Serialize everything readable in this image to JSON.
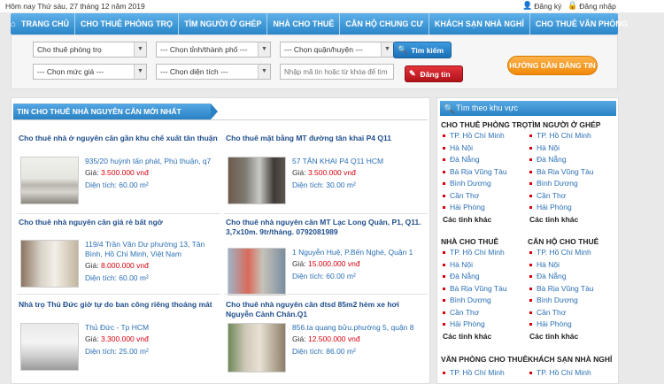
{
  "topbar": {
    "date": "Hôm nay Thứ sáu, 27 tháng 12 năm 2019",
    "register": "Đăng ký",
    "login": "Đăng nhập"
  },
  "nav": {
    "items": [
      "TRANG CHỦ",
      "CHO THUÊ PHÒNG TRỌ",
      "TÌM NGƯỜI Ở GHÉP",
      "NHÀ CHO THUÊ",
      "CĂN HỘ CHUNG CƯ",
      "KHÁCH SẠN NHÀ NGHỈ",
      "CHO THUÊ VĂN PHÒNG"
    ]
  },
  "search": {
    "category": "Cho thuê phòng trọ",
    "province": "--- Chọn tỉnh/thành phố ---",
    "district": "--- Chọn quận/huyện ---",
    "price": "--- Chọn mức giá ---",
    "area": "--- Chọn diện tích ---",
    "keyword_placeholder": "Nhập mã tin hoặc từ khóa để tìm",
    "search_label": "Tìm kiếm",
    "post_label": "Đăng tin",
    "guide_label": "HƯỚNG DẪN ĐĂNG TIN"
  },
  "main": {
    "heading": "TIN CHO THUÊ NHÀ NGUYÊN CĂN MỚI NHẤT",
    "listings": [
      {
        "title": "Cho thuê nhà ở nguyên căn gần khu chế xuất tân thuận",
        "address": "935/20 huỳnh tấn phát, Phú thuận, q7",
        "price_label": "Giá:",
        "price": "3.500.000 vnđ",
        "area": "Diện tích: 60.00 m²"
      },
      {
        "title": "Cho thuê mặt bằng MT đường tân khai P4 Q11",
        "address": "57 TÂN KHAI P4 Q11 HCM",
        "price_label": "Giá:",
        "price": "3.500.000 vnđ",
        "area": "Diện tích: 30.00 m²"
      },
      {
        "title": "Cho thuê nhà nguyên căn giá rẻ bất ngờ",
        "address": "119/4 Trần Văn Dư phường 13, Tân Bình, Hồ Chí Minh, Việt Nam",
        "price_label": "Giá:",
        "price": "8.000.000 vnđ",
        "area": "Diện tích: 60.00 m²"
      },
      {
        "title": "Cho thuê nhà nguyên căn MT Lạc Long Quân, P1, Q11. 3,7x10m. 9tr/tháng. 0792081989",
        "address": "1 Nguyễn Huệ, P.Bến Nghé, Quận 1",
        "price_label": "Giá:",
        "price": "15.000.000 vnđ",
        "area": "Diện tích: 60.00 m²"
      },
      {
        "title": "Nhà trọ Thủ Đức giờ tự do ban công riêng thoáng mát",
        "address": "Thủ Đức - Tp HCM",
        "price_label": "Giá:",
        "price": "3.300.000 vnđ",
        "area": "Diện tích: 25.00 m²"
      },
      {
        "title": "Cho thuê nhà nguyên căn dtsd 85m2 hẻm xe hơi Nguyễn Cảnh Chân.Q1",
        "address": "856.ta quang bửu.phường 5, quận 8",
        "price_label": "Giá:",
        "price": "12.500.000 vnđ",
        "area": "Diện tích: 86.00 m²"
      }
    ]
  },
  "sidebar": {
    "heading": "Tìm theo khu vực",
    "groups": [
      {
        "title": "CHO THUÊ PHÒNG TRỌ",
        "items": [
          "TP. Hồ Chí Minh",
          "Hà Nội",
          "Đà Nẵng",
          "Bà Rịa Vũng Tàu",
          "Bình Dương",
          "Cần Thơ",
          "Hải Phòng"
        ],
        "more": "Các tỉnh khác"
      },
      {
        "title": "TÌM NGƯỜI Ở GHÉP",
        "items": [
          "TP. Hồ Chí Minh",
          "Hà Nội",
          "Đà Nẵng",
          "Bà Rịa Vũng Tàu",
          "Bình Dương",
          "Cần Thơ",
          "Hải Phòng"
        ],
        "more": "Các tỉnh khác"
      },
      {
        "title": "NHÀ CHO THUÊ",
        "items": [
          "TP. Hồ Chí Minh",
          "Hà Nội",
          "Đà Nẵng",
          "Bà Rịa Vũng Tàu",
          "Bình Dương",
          "Cần Thơ",
          "Hải Phòng"
        ],
        "more": "Các tỉnh khác"
      },
      {
        "title": "CĂN HỘ CHO THUÊ",
        "items": [
          "TP. Hồ Chí Minh",
          "Hà Nội",
          "Đà Nẵng",
          "Bà Rịa Vũng Tàu",
          "Bình Dương",
          "Cần Thơ",
          "Hải Phòng"
        ],
        "more": "Các tỉnh khác"
      },
      {
        "title": "VĂN PHÒNG CHO THUÊ",
        "items": [
          "TP. Hồ Chí Minh"
        ]
      },
      {
        "title": "KHÁCH SẠN NHÀ NGHỈ",
        "items": [
          "TP. Hồ Chí Minh"
        ]
      }
    ]
  }
}
